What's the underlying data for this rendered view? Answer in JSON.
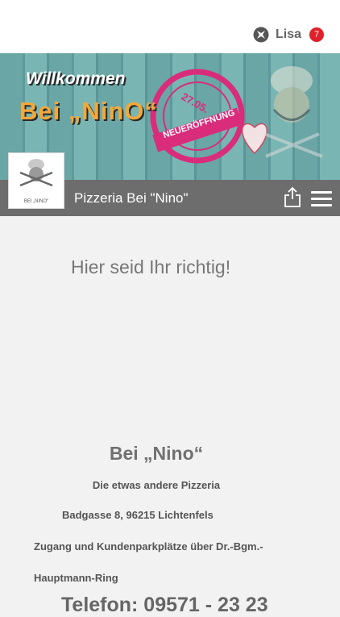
{
  "user": {
    "name": "Lisa",
    "badge_count": "7"
  },
  "banner": {
    "welcome": "Willkommen",
    "name": "Bei  „NinO“",
    "stamp_date": "27.05.",
    "stamp_text": "NEUERÖFFNUNG"
  },
  "header": {
    "title": "Pizzeria Bei \"Nino\"",
    "logo_caption": "BEI „NINO“"
  },
  "content": {
    "headline": "Hier seid Ihr richtig!",
    "restaurant_name": "Bei  „Nino“",
    "slogan": "Die etwas andere Pizzeria",
    "address": "Badgasse 8, 96215 Lichtenfels",
    "access_line1": "Zugang und Kundenparkplätze über Dr.-Bgm.-",
    "access_line2": "Hauptmann-Ring",
    "phone": "Telefon: 09571 - 23 23"
  },
  "colors": {
    "accent": "#e0202a",
    "titlebar": "#6d6d6d",
    "stamp": "#d92c7b"
  }
}
